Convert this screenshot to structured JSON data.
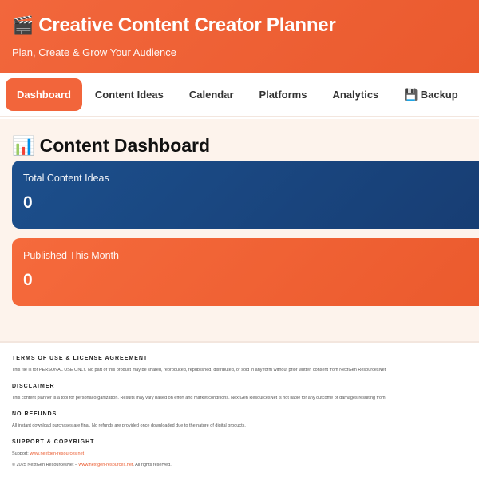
{
  "header": {
    "icon": "🎬",
    "title": "Creative Content Creator Planner",
    "subtitle": "Plan, Create & Grow Your Audience"
  },
  "nav": {
    "tabs": [
      {
        "label": "Dashboard",
        "active": true
      },
      {
        "label": "Content Ideas"
      },
      {
        "label": "Calendar"
      },
      {
        "label": "Platforms"
      },
      {
        "label": "Analytics"
      },
      {
        "label": "Backup",
        "icon": "💾"
      }
    ]
  },
  "dashboard": {
    "icon": "📊",
    "title": "Content Dashboard",
    "cards": [
      {
        "label": "Total Content Ideas",
        "value": "0"
      },
      {
        "label": "Published This Month",
        "value": "0"
      }
    ]
  },
  "footer": {
    "terms_head": "TERMS OF USE & LICENSE AGREEMENT",
    "terms_text": "This file is for PERSONAL USE ONLY. No part of this product may be shared, reproduced, republished, distributed, or sold in any form without prior written consent from NextGen ResourcesNet",
    "disclaimer_head": "DISCLAIMER",
    "disclaimer_text": "This content planner is a tool for personal organization. Results may vary based on effort and market conditions. NextGen ResourcesNet is not liable for any outcome or damages resulting from",
    "refunds_head": "NO REFUNDS",
    "refunds_text": "All instant download purchases are final. No refunds are provided once downloaded due to the nature of digital products.",
    "support_head": "SUPPORT & COPYRIGHT",
    "support_prefix": "Support: ",
    "support_link": "www.nextgen-resources.net",
    "copyright_prefix": "© 2025 NextGen ResourcesNet – ",
    "copyright_link": "www.nextgen-resources.net",
    "copyright_suffix": ". All rights reserved."
  },
  "colors": {
    "accent": "#f2653b",
    "card_blue": "#1c4f8c",
    "background": "#fdf3ec"
  }
}
